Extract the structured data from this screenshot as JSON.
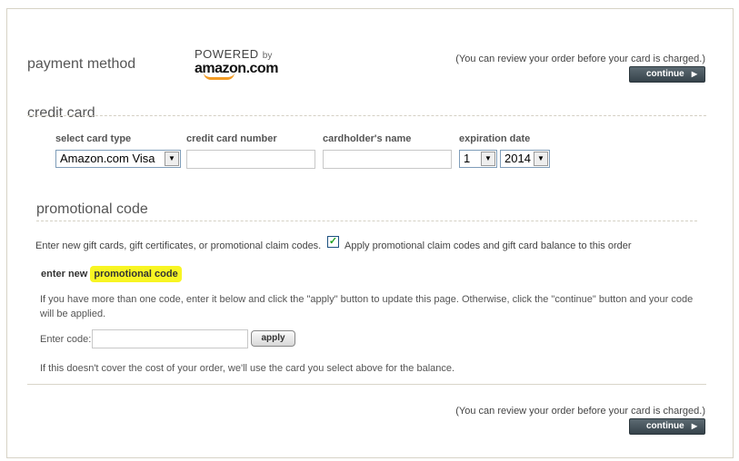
{
  "header": {
    "title": "payment method",
    "powered_by": {
      "line1": "POWERED",
      "by": "by",
      "brand": "amazon.com"
    },
    "review_note": "(You can review your order before your card is charged.)",
    "continue_label": "continue"
  },
  "credit_card": {
    "title": "credit card",
    "labels": {
      "card_type": "select card type",
      "card_number": "credit card number",
      "holder": "cardholder's name",
      "expiration": "expiration date"
    },
    "card_type_value": "Amazon.com Visa",
    "card_number_value": "",
    "holder_value": "",
    "exp_month": "1",
    "exp_year": "2014"
  },
  "promo": {
    "title": "promotional code",
    "enter_text": "Enter new gift cards, gift certificates, or promotional claim codes.",
    "apply_balance_checked": true,
    "apply_balance_label": "Apply promotional claim codes and gift card balance to this order",
    "enter_new_prefix": "enter new",
    "enter_new_highlight": "promotional code",
    "info": "If you have more than one code, enter it below and click the \"apply\" button to update this page. Otherwise, click the \"continue\" button and your code will be applied.",
    "code_label": "Enter code:",
    "code_value": "",
    "apply_label": "apply",
    "balance_note": "If this doesn't cover the cost of your order, we'll use the card you select above for the balance."
  },
  "footer": {
    "review_note": "(You can review your order before your card is charged.)",
    "continue_label": "continue"
  }
}
